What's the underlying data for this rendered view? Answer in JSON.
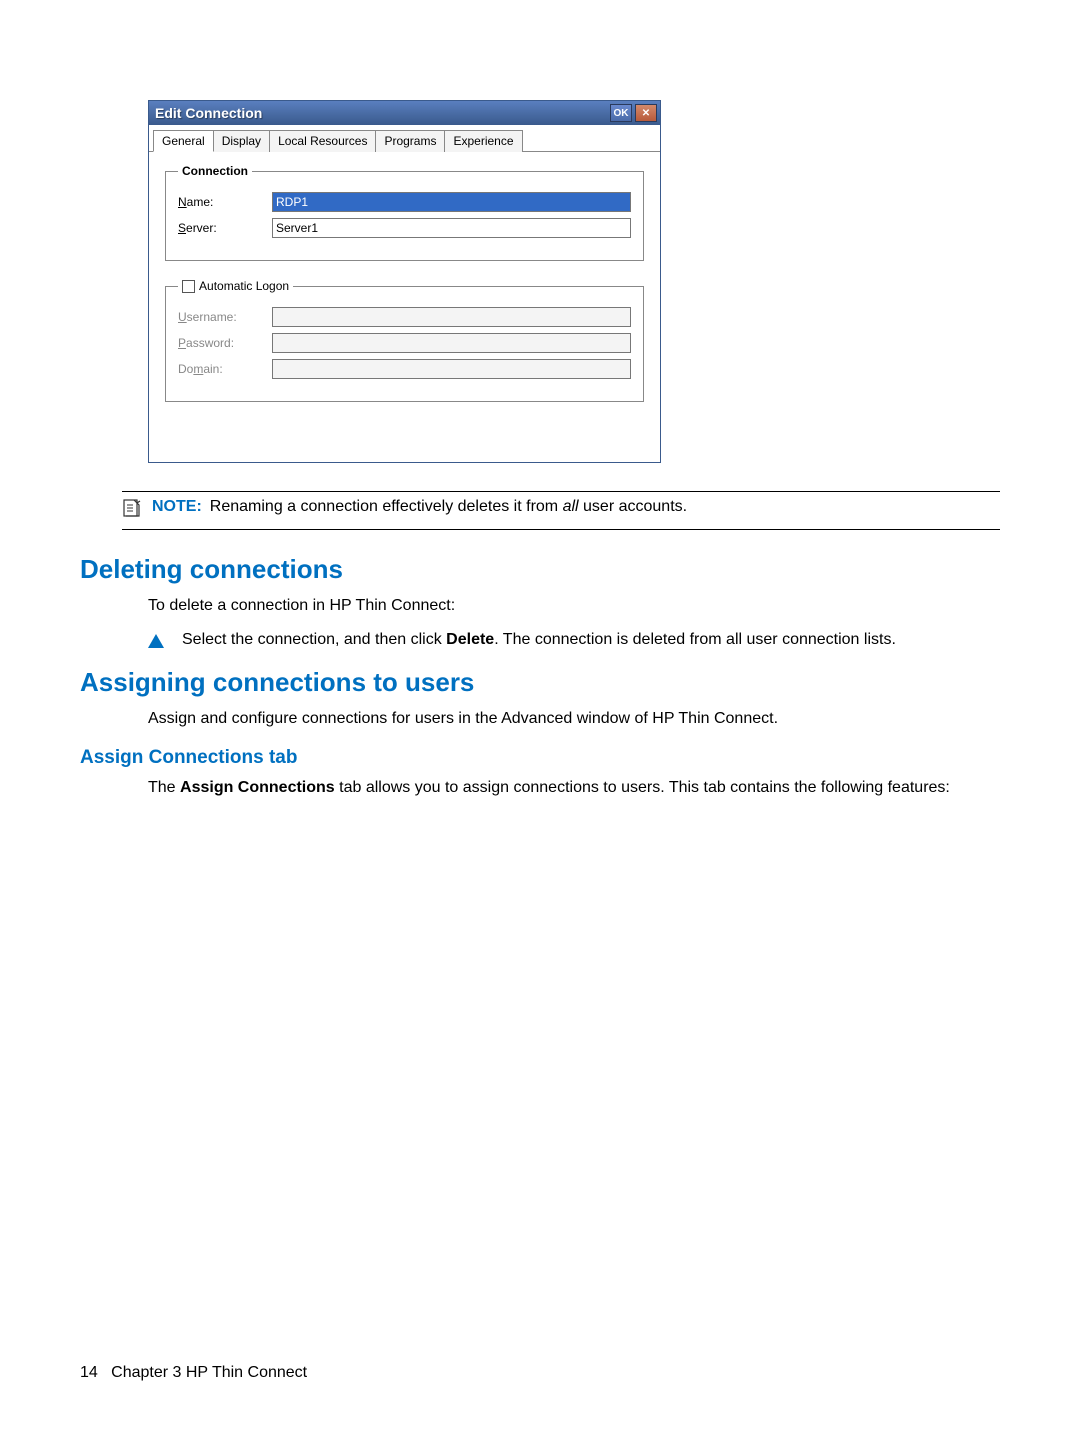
{
  "dialog": {
    "title": "Edit Connection",
    "ok": "OK",
    "tabs": {
      "general": "General",
      "display": "Display",
      "local": "Local Resources",
      "programs": "Programs",
      "experience": "Experience"
    },
    "connection": {
      "legend": "Connection",
      "name_label_pre": "N",
      "name_label_post": "ame:",
      "name_value": "RDP1",
      "server_label_pre": "S",
      "server_label_post": "erver:",
      "server_value": "Server1"
    },
    "logon": {
      "legend_pre": "Au",
      "legend_ul": "t",
      "legend_post": "omatic Logon",
      "user_label_pre": "U",
      "user_label_post": "sername:",
      "user_value": "",
      "pass_label_pre": "P",
      "pass_label_post": "assword:",
      "pass_value": "",
      "domain_label_pre": "Do",
      "domain_label_ul": "m",
      "domain_label_post": "ain:",
      "domain_value": ""
    }
  },
  "note": {
    "label": "NOTE:",
    "text_pre": "Renaming a connection effectively deletes it from ",
    "text_em": "all",
    "text_post": " user accounts."
  },
  "sec_deleting": {
    "heading": "Deleting connections",
    "intro": "To delete a connection in HP Thin Connect:",
    "bullet_pre": "Select the connection, and then click ",
    "bullet_bold": "Delete",
    "bullet_post": ". The connection is deleted from all user connection lists."
  },
  "sec_assigning": {
    "heading": "Assigning connections to users",
    "intro": "Assign and configure connections for users in the Advanced window of HP Thin Connect."
  },
  "sec_assign_tab": {
    "heading": "Assign Connections tab",
    "para_pre": "The ",
    "para_bold": "Assign Connections",
    "para_post": " tab allows you to assign connections to users. This tab contains the following features:"
  },
  "footer": {
    "page": "14",
    "chapter": "Chapter 3   HP Thin Connect"
  }
}
